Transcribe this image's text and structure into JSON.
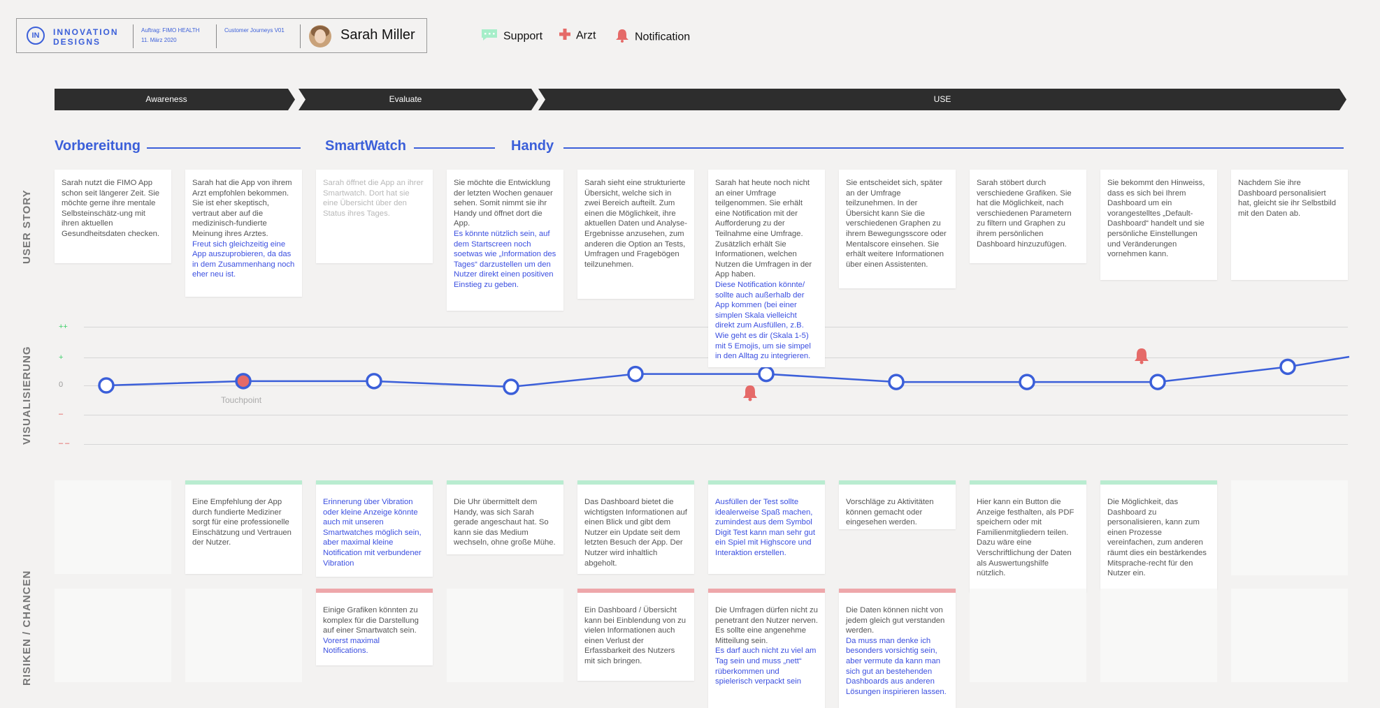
{
  "header": {
    "logo_line1": "INNOVATION",
    "logo_line2": "DESIGNS",
    "logo_mark": "IN",
    "auftrag": "Auftrag: FIMO HEALTH",
    "date": "11. März 2020",
    "doc": "Customer Journeys V01",
    "user_name": "Sarah Miller"
  },
  "legend": [
    {
      "label": "Support",
      "icon": "chat-icon",
      "color": "#a6eec9"
    },
    {
      "label": "Arzt",
      "icon": "medical-cross-icon",
      "color": "#e56a68"
    },
    {
      "label": "Notification",
      "icon": "bell-icon",
      "color": "#e56a68"
    }
  ],
  "phases": [
    "Awareness",
    "Evaluate",
    "USE"
  ],
  "sections": [
    "Vorbereitung",
    "SmartWatch",
    "Handy"
  ],
  "row_labels": {
    "story": "USER STORY",
    "vis": "VISUALISIERUNG",
    "risk": "RISIKEN / CHANCEN"
  },
  "story": [
    {
      "text": "Sarah nutzt die FIMO App schon seit längerer Zeit. Sie möchte gerne ihre mentale Selbsteinschätz-ung mit ihren aktuellen Gesundheitsdaten checken.",
      "hl": ""
    },
    {
      "text": "Sarah hat die App von ihrem Arzt empfohlen bekommen. Sie ist eher skeptisch, vertraut aber auf die medizinisch-fundierte Meinung ihres Arztes.",
      "hl": "Freut sich gleichzeitig eine App auszuprobieren, da das in dem Zusammenhang noch eher neu ist."
    },
    {
      "text": "Sarah öffnet die App an ihrer Smartwatch. Dort hat sie eine Übersicht über den Status ihres Tages.",
      "hl": ""
    },
    {
      "text": "Sie möchte die Entwicklung der letzten Wochen genauer sehen. Somit nimmt sie ihr Handy und öffnet dort die App.",
      "hl": "Es könnte nützlich sein, auf dem Startscreen noch soetwas wie „Information des Tages“ darzustellen um den Nutzer direkt einen positiven Einstieg zu geben."
    },
    {
      "text": "Sarah sieht eine strukturierte Übersicht, welche sich in zwei Bereich aufteilt. Zum einen die Möglichkeit, ihre aktuellen Daten und Analyse-Ergebnisse anzusehen, zum anderen die Option an Tests, Umfragen und Fragebögen teilzunehmen.",
      "hl": ""
    },
    {
      "text": "Sarah hat heute noch nicht an einer Umfrage teilgenommen. Sie erhält eine Notification mit der Aufforderung zu der Teilnahme eine Umfrage. Zusätzlich erhält Sie Informationen, welchen Nutzen die Umfragen in der App haben.",
      "hl": "Diese Notification könnte/ sollte auch außerhalb der App kommen (bei einer simplen Skala vielleicht direkt zum Ausfüllen, z.B. Wie geht es dir (Skala 1-5) mit 5 Emojis, um sie simpel in den Alltag zu integrieren."
    },
    {
      "text": "Sie entscheidet sich, später an der Umfrage teilzunehmen. In der Übersicht kann Sie die verschiedenen Graphen zu ihrem Bewegungsscore oder Mentalscore einsehen. Sie erhält weitere Informationen über einen Assistenten.",
      "hl": ""
    },
    {
      "text": "Sarah stöbert durch verschiedene Grafiken. Sie hat die Möglichkeit, nach verschiedenen Parametern zu filtern und Graphen zu ihrem persönlichen Dashboard hinzuzufügen.",
      "hl": ""
    },
    {
      "text": "Sie bekommt den Hinweiss, dass es sich bei Ihrem Dashboard um ein vorangestelltes „Default-Dashboard“ handelt und sie persönliche Einstellungen und Veränderungen vornehmen kann.",
      "hl": ""
    },
    {
      "text": "Nachdem Sie ihre Dashboard personalisiert hat, gleicht sie ihr Selbstbild mit den Daten ab.",
      "hl": ""
    }
  ],
  "chart_data": {
    "type": "line",
    "levels": [
      "++",
      "+",
      "0",
      "–",
      "– –"
    ],
    "x": [
      1,
      2,
      3,
      4,
      5,
      6,
      7,
      8,
      9,
      10,
      11
    ],
    "values": [
      0,
      0.15,
      0.15,
      -0.05,
      0.4,
      0.4,
      0.12,
      0.12,
      0.12,
      0.65,
      1.0
    ],
    "ylim": [
      -2,
      2
    ],
    "touchpoint_label": "Touchpoint",
    "touchpoints": [
      2
    ],
    "notifications": [
      {
        "x": 6.0,
        "y": 0
      },
      {
        "x": 9.0,
        "y": 1
      }
    ]
  },
  "chances": [
    {
      "text": "",
      "hl": "",
      "empty": true
    },
    {
      "text": "Eine Empfehlung der App durch fundierte Mediziner sorgt für eine professionelle Einschätzung und Vertrauen der Nutzer.",
      "hl": ""
    },
    {
      "text": "",
      "hl": "Erinnerung über Vibration oder kleine Anzeige könnte auch mit unseren Smartwatches möglich sein, aber maximal kleine Notification mit verbundener Vibration"
    },
    {
      "text": "Die Uhr übermittelt dem Handy, was sich Sarah gerade angeschaut hat. So kann sie das Medium wechseln, ohne große Mühe.",
      "hl": ""
    },
    {
      "text": "Das Dashboard bietet die wichtigsten Informationen auf einen Blick und gibt dem Nutzer ein Update seit dem letzten Besuch der App. Der Nutzer wird inhaltlich abgeholt.",
      "hl": ""
    },
    {
      "text": "",
      "hl": "Ausfüllen der Test sollte idealerweise Spaß machen, zumindest aus dem Symbol Digit Test kann man sehr gut ein Spiel mit Highscore und Interaktion erstellen."
    },
    {
      "text": "Vorschläge zu Aktivitäten können gemacht oder eingesehen werden.",
      "hl": ""
    },
    {
      "text": "Hier kann ein Button die Anzeige festhalten, als PDF speichern oder mit Familienmitgliedern teilen. Dazu wäre eine Verschriftlichung der Daten als Auswertungshilfe nützlich.",
      "hl": ""
    },
    {
      "text": "Die Möglichkeit, das Dashboard zu personalisieren, kann zum einen Prozesse vereinfachen, zum anderen räumt dies ein bestärkendes Mitsprache-recht für den Nutzer ein.",
      "hl": ""
    },
    {
      "text": "",
      "hl": "",
      "empty": true
    }
  ],
  "risks": [
    {
      "text": "",
      "hl": "",
      "empty": true
    },
    {
      "text": "",
      "hl": "",
      "empty": true
    },
    {
      "text": "Einige Grafiken könnten zu komplex für die Darstellung auf einer Smartwatch sein.",
      "hl": "Vorerst maximal Notifications."
    },
    {
      "text": "",
      "hl": "",
      "empty": true
    },
    {
      "text": "Ein Dashboard / Übersicht kann bei Einblendung von zu vielen Informationen auch einen Verlust der Erfassbarkeit des Nutzers mit sich bringen.",
      "hl": ""
    },
    {
      "text": "Die Umfragen dürfen nicht zu penetrant den Nutzer nerven. Es sollte eine angenehme Mitteilung sein.",
      "hl": "Es darf auch nicht zu viel am Tag sein und muss „nett“ rüberkommen und spielerisch verpackt sein"
    },
    {
      "text": "Die Daten können nicht von jedem gleich gut verstanden werden.",
      "hl": "Da muss man denke ich besonders vorsichtig sein, aber vermute da kann man sich gut an bestehenden Dashboards aus anderen Lösungen inspirieren lassen."
    },
    {
      "text": "",
      "hl": "",
      "empty": true
    },
    {
      "text": "",
      "hl": "",
      "empty": true
    },
    {
      "text": "",
      "hl": "",
      "empty": true
    }
  ]
}
